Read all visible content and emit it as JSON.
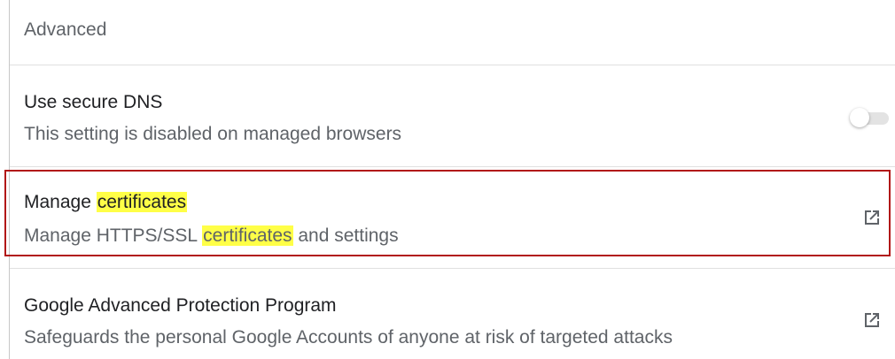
{
  "section": {
    "title": "Advanced"
  },
  "rows": {
    "secure_dns": {
      "title": "Use secure DNS",
      "subtitle": "This setting is disabled on managed browsers",
      "toggle_state": "off-disabled"
    },
    "manage_certificates": {
      "title_prefix": "Manage ",
      "title_highlight": "certificates",
      "subtitle_prefix": "Manage HTTPS/SSL ",
      "subtitle_highlight": "certificates",
      "subtitle_suffix": " and settings",
      "icon": "open-in-new-icon"
    },
    "advanced_protection": {
      "title": "Google Advanced Protection Program",
      "subtitle": "Safeguards the personal Google Accounts of anyone at risk of targeted attacks",
      "icon": "open-in-new-icon"
    }
  },
  "colors": {
    "search_highlight": "#ffff47",
    "selection_border": "#b11717"
  }
}
